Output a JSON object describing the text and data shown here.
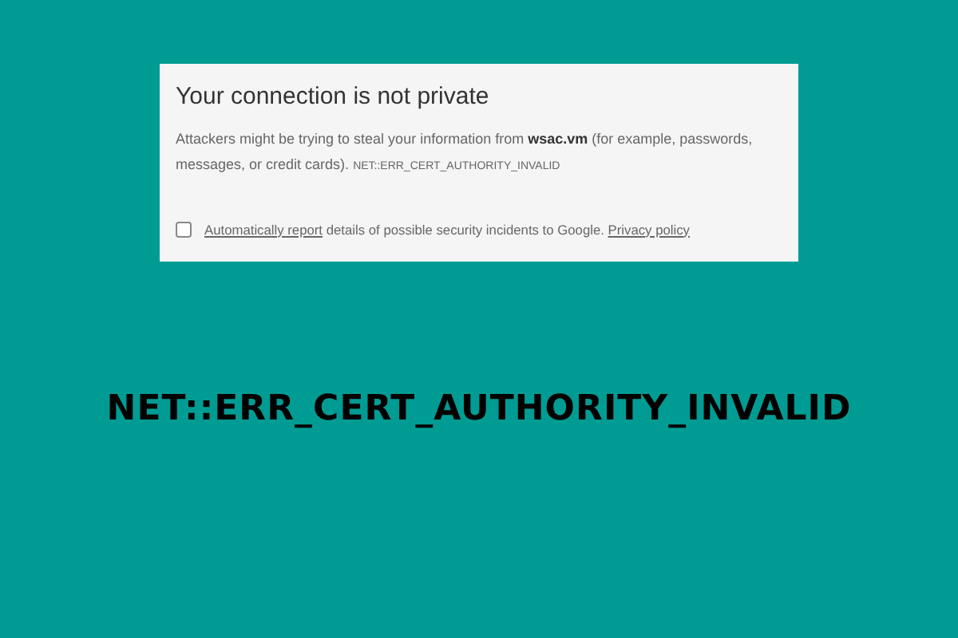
{
  "dialog": {
    "title": "Your connection is not private",
    "message": "Attackers might be trying to steal your information from **wsac.vm** (for example, passwords, messages, or credit cards).",
    "error_code": "NET::ERR_CERT_AUTHORITY_INVALID",
    "report": {
      "checked": false,
      "link": "Automatically report",
      "text": "details of possible security incidents to Google.",
      "policy_link": "Privacy policy"
    }
  },
  "headline": "NET::ERR_CERT_AUTHORITY_INVALID"
}
